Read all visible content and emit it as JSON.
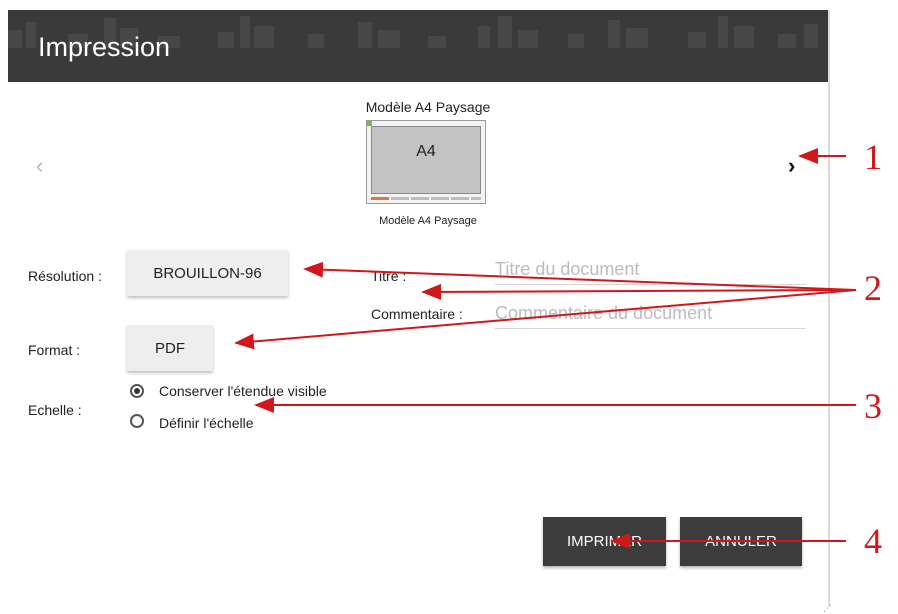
{
  "dialog": {
    "title": "Impression",
    "template_name_top": "Modèle A4 Paysage",
    "thumbnail_label": "A4",
    "template_name_bottom": "Modèle A4 Paysage",
    "nav_prev_glyph": "‹",
    "nav_next_glyph": "›"
  },
  "form": {
    "resolution_label": "Résolution :",
    "resolution_value": "BROUILLON-96",
    "format_label": "Format :",
    "format_value": "PDF",
    "title_label": "Titre :",
    "title_placeholder": "Titre du document",
    "comment_label": "Commentaire :",
    "comment_placeholder": "Commentaire du document",
    "scale_label": "Echelle :",
    "scale_options": [
      {
        "label": "Conserver l'étendue visible",
        "checked": true
      },
      {
        "label": "Définir l'échelle",
        "checked": false
      }
    ]
  },
  "actions": {
    "print_label": "IMPRIMER",
    "cancel_label": "ANNULER"
  },
  "callouts": [
    "1",
    "2",
    "3",
    "4"
  ],
  "colors": {
    "header_bg": "#3a3a3a",
    "button_dark": "#3c3c3c",
    "annotation_red": "#d0181c"
  }
}
